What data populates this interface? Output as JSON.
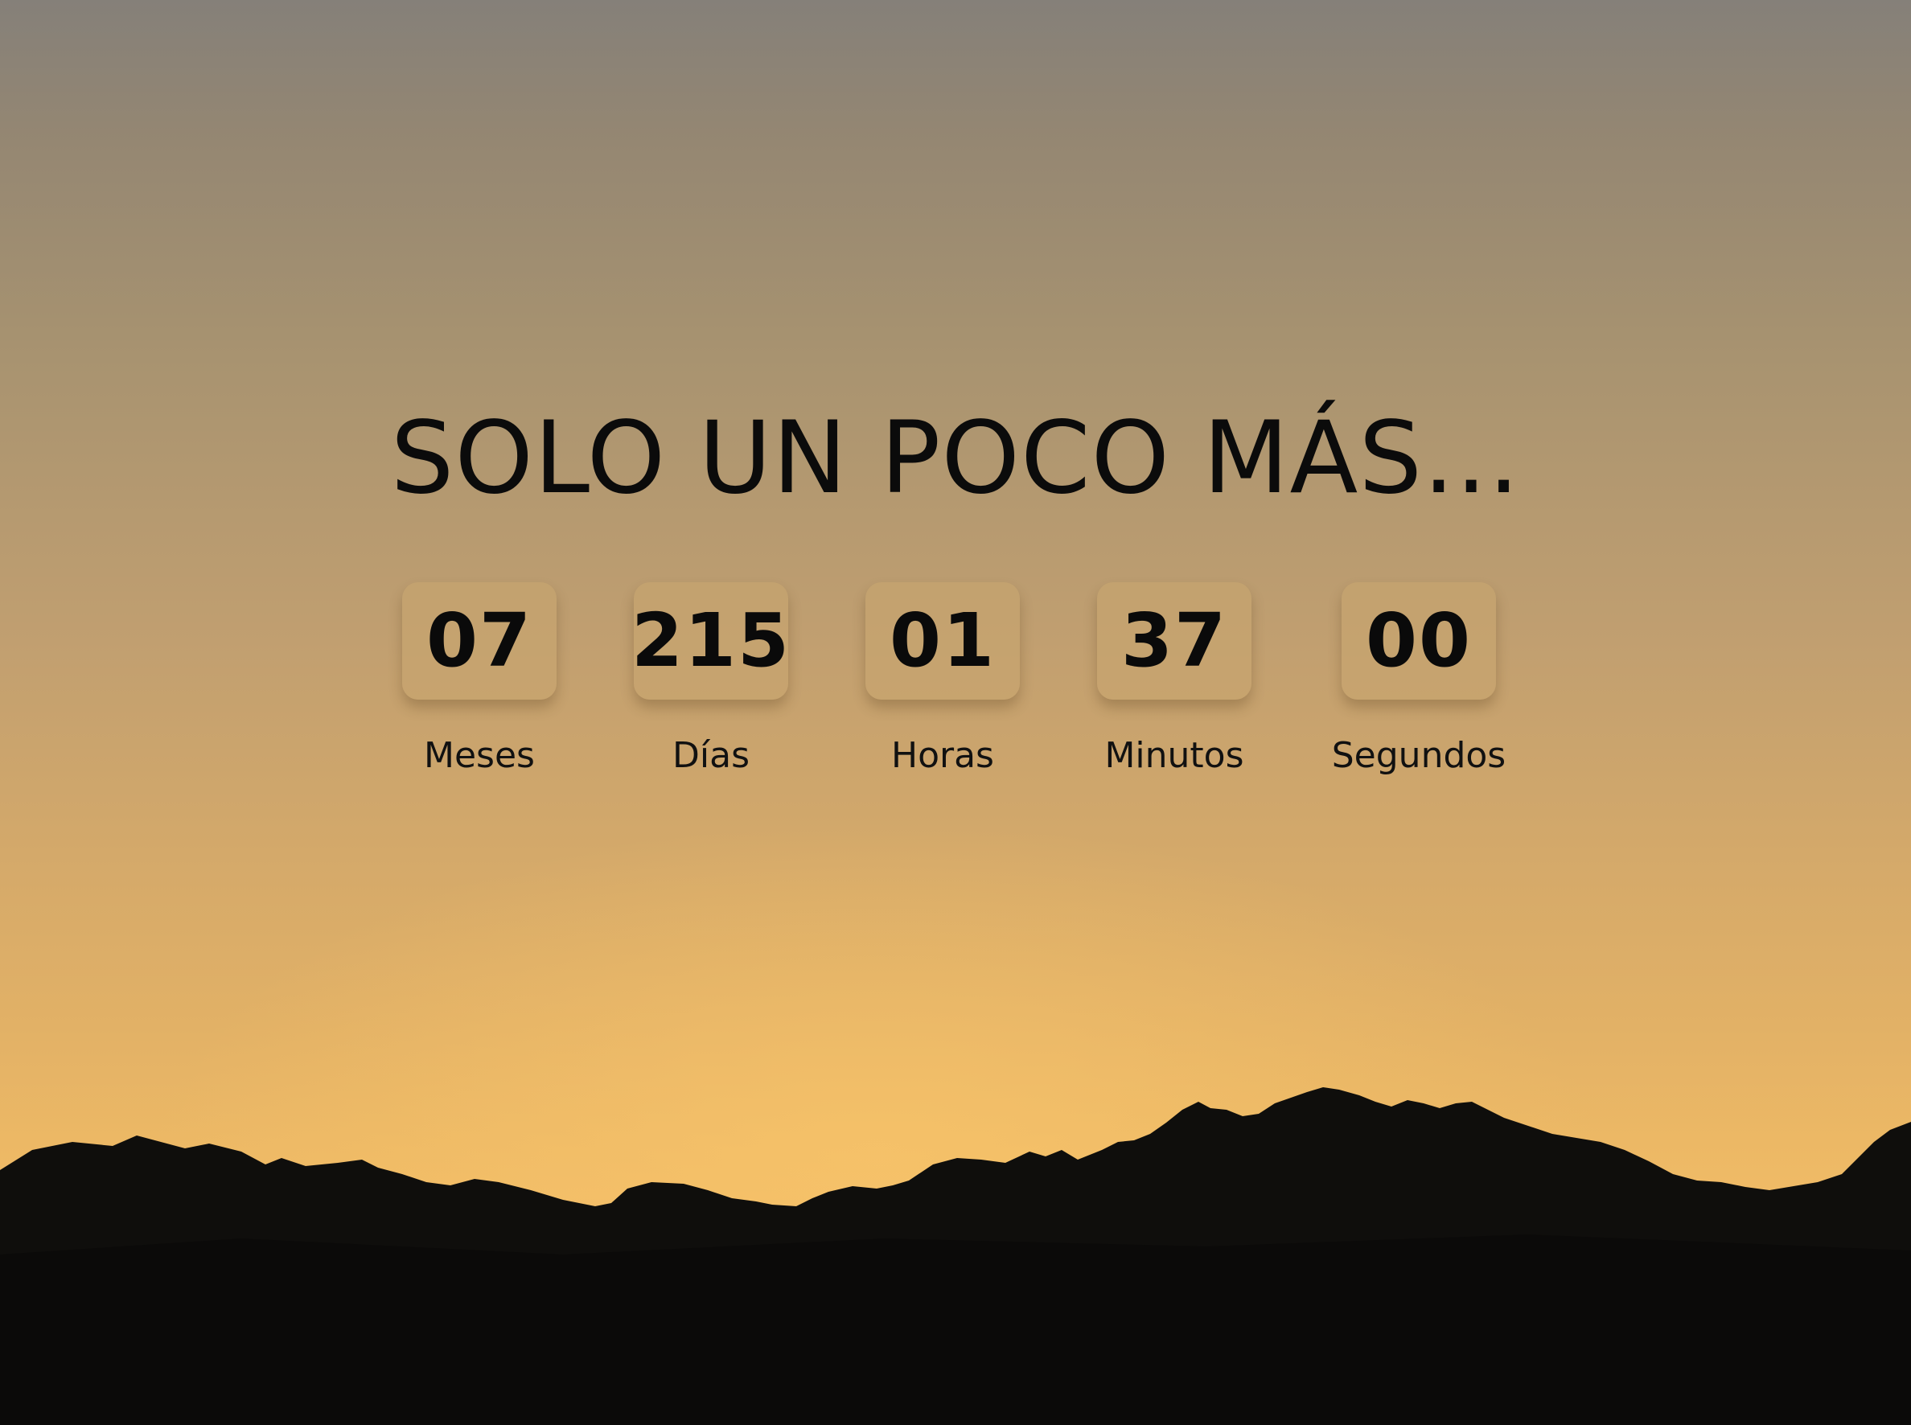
{
  "heading": "SOLO UN POCO MÁS...",
  "countdown": [
    {
      "value": "07",
      "label": "Meses"
    },
    {
      "value": "215",
      "label": "Días"
    },
    {
      "value": "01",
      "label": "Horas"
    },
    {
      "value": "37",
      "label": "Minutos"
    },
    {
      "value": "00",
      "label": "Segundos"
    }
  ],
  "colors": {
    "sky_top": "#858079",
    "sky_glow": "#f0bb66",
    "mountain": "#0d0c0b",
    "text": "#0b0b0b"
  }
}
